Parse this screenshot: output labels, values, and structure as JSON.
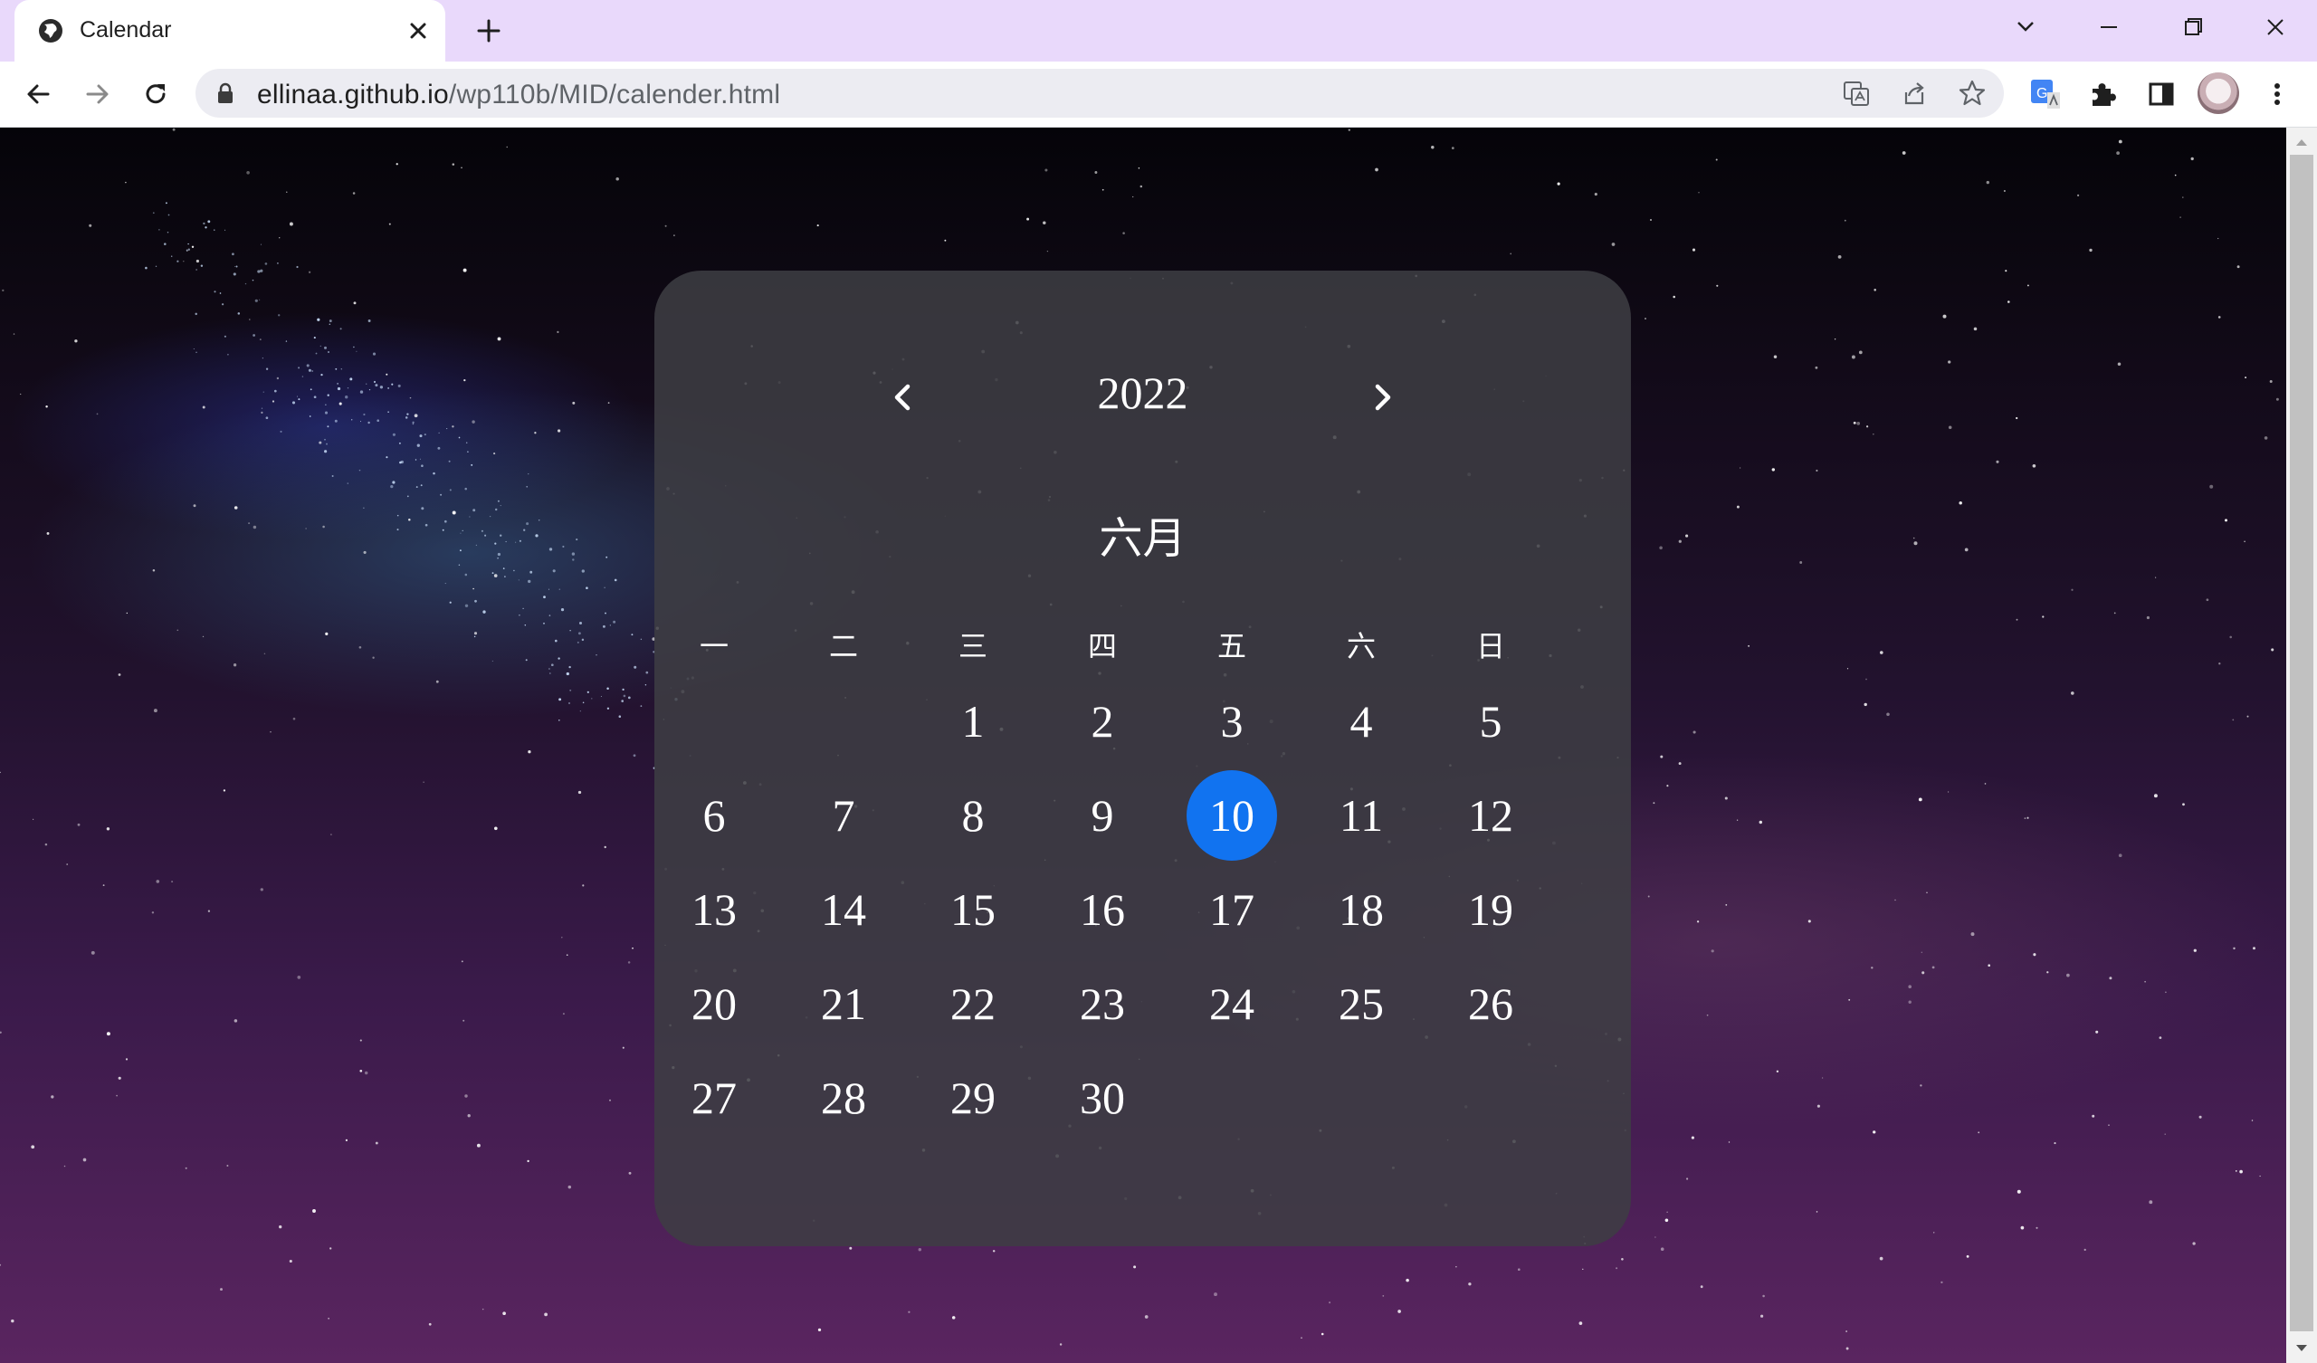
{
  "browser": {
    "tab_title": "Calendar",
    "url_host": "ellinaa.github.io",
    "url_path": "/wp110b/MID/calender.html"
  },
  "calendar": {
    "year": "2022",
    "month": "六月",
    "weekdays": [
      "一",
      "二",
      "三",
      "四",
      "五",
      "六",
      "日"
    ],
    "days": [
      "1",
      "2",
      "3",
      "4",
      "5",
      "6",
      "7",
      "8",
      "9",
      "10",
      "11",
      "12",
      "13",
      "14",
      "15",
      "16",
      "17",
      "18",
      "19",
      "20",
      "21",
      "22",
      "23",
      "24",
      "25",
      "26",
      "27",
      "28",
      "29",
      "30"
    ],
    "first_weekday_index": 2,
    "selected_day": "10",
    "selected_color": "#1173f0"
  }
}
